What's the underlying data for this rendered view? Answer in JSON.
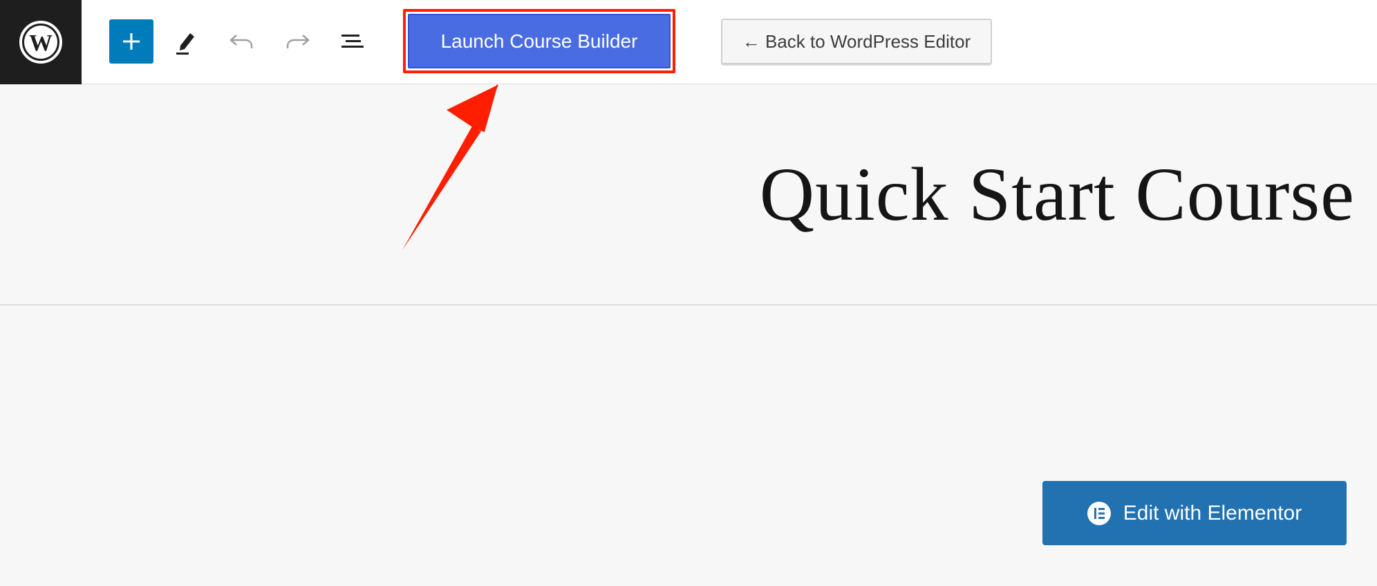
{
  "toolbar": {
    "logo_icon": "wordpress-logo-icon",
    "add_icon": "plus-icon",
    "tools_icon": "pencil-icon",
    "undo_icon": "undo-icon",
    "redo_icon": "redo-icon",
    "list_view_icon": "list-view-icon",
    "launch_label": "Launch Course Builder",
    "back_label": "← Back to WordPress Editor"
  },
  "page": {
    "title": "Quick Start Course",
    "elementor_label": "Edit with Elementor",
    "elementor_icon": "elementor-icon"
  },
  "colors": {
    "topbar_bg": "#ffffff",
    "logo_bg": "#1e1e1e",
    "add_button": "#007cba",
    "launch_button": "#4a6ce3",
    "highlight": "#ff1f00",
    "elementor_button": "#2271b1",
    "canvas_bg": "#f7f7f7"
  },
  "annotation": {
    "type": "arrow",
    "color": "#ff1f00"
  }
}
